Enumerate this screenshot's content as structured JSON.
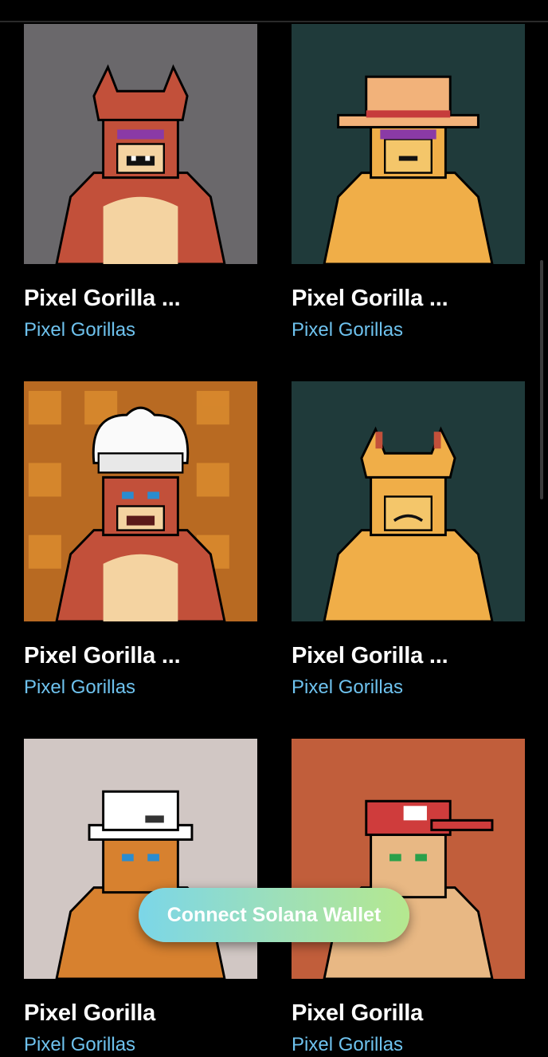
{
  "items": [
    {
      "title": "Pixel Gorilla ...",
      "collection": "Pixel Gorillas",
      "bg": "#6a686b",
      "fur": "#c2503a",
      "hat": "devil-horns"
    },
    {
      "title": "Pixel Gorilla ...",
      "collection": "Pixel Gorillas",
      "bg": "#1f3a3a",
      "fur": "#f0ae48",
      "hat": "straw-hat"
    },
    {
      "title": "Pixel Gorilla ...",
      "collection": "Pixel Gorillas",
      "bg": "#b86a22",
      "fur": "#c2503a",
      "hat": "chef-hat"
    },
    {
      "title": "Pixel Gorilla ...",
      "collection": "Pixel Gorillas",
      "bg": "#1f3a3a",
      "fur": "#f0ae48",
      "hat": "devil-horns"
    },
    {
      "title": "Pixel Gorilla",
      "collection": "Pixel Gorillas",
      "bg": "#d1c7c4",
      "fur": "#d7812f",
      "hat": "bucket-hat"
    },
    {
      "title": "Pixel Gorilla",
      "collection": "Pixel Gorillas",
      "bg": "#c15e3b",
      "fur": "#e8b884",
      "hat": "cap"
    }
  ],
  "connect_button": {
    "label": "Connect Solana Wallet"
  },
  "colors": {
    "accent_link": "#6ec2ee",
    "background": "#000000"
  }
}
